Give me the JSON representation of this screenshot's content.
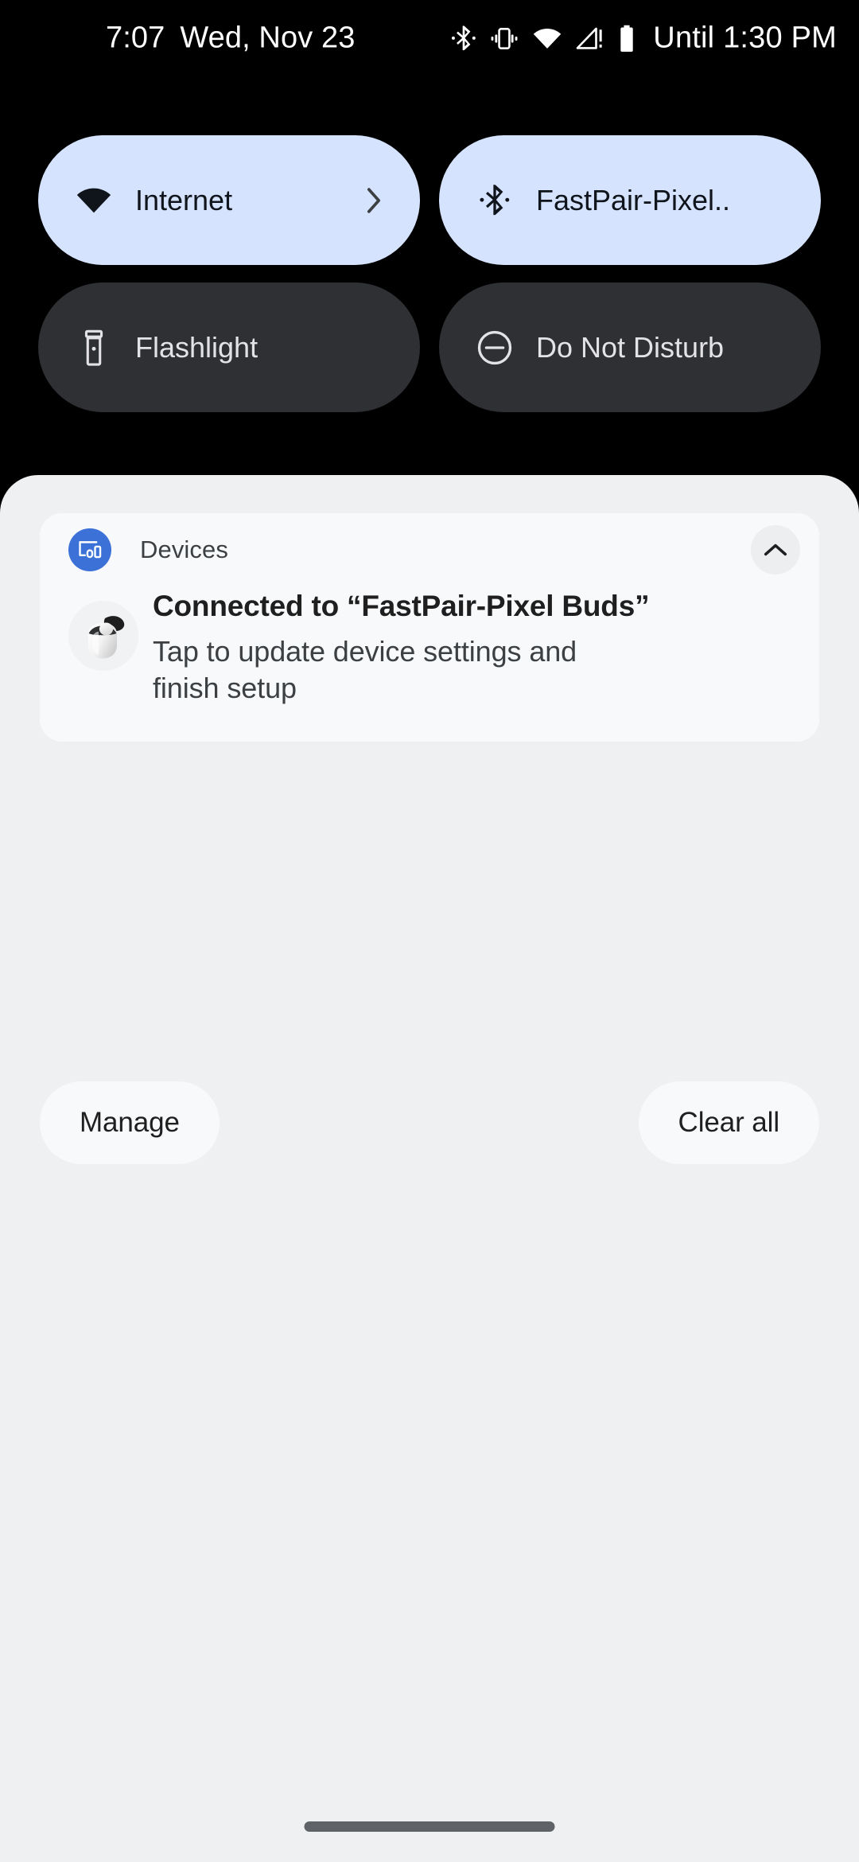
{
  "status_bar": {
    "time": "7:07",
    "date": "Wed, Nov 23",
    "icons": [
      "bluetooth-icon",
      "vibrate-icon",
      "wifi-icon",
      "signal-no-service-icon",
      "battery-icon"
    ],
    "battery_note": "Until 1:30 PM"
  },
  "quick_settings": {
    "tiles": [
      {
        "label": "Internet",
        "icon": "wifi-icon",
        "state": "on",
        "has_chevron": true
      },
      {
        "label": "FastPair-Pixel..",
        "icon": "bluetooth-icon",
        "state": "on",
        "has_chevron": false
      },
      {
        "label": "Flashlight",
        "icon": "flashlight-icon",
        "state": "off",
        "has_chevron": false
      },
      {
        "label": "Do Not Disturb",
        "icon": "do-not-disturb-icon",
        "state": "off",
        "has_chevron": false
      }
    ]
  },
  "notification": {
    "app_name": "Devices",
    "app_icon": "devices-cast-icon",
    "collapse_icon": "chevron-up-icon",
    "thumbnail": "pixel-buds-case-image",
    "title": "Connected to “FastPair-Pixel Buds”",
    "body": "Tap to update device settings and finish setup"
  },
  "actions": {
    "manage": "Manage",
    "clear_all": "Clear all"
  },
  "colors": {
    "tile_on_bg": "#D5E3FF",
    "tile_off_bg": "#2F3033",
    "panel_bg": "#EFF0F2",
    "card_bg": "#F8F9FA",
    "app_icon_blue": "#3C71D8",
    "gesture_bar": "#5F6368"
  },
  "navigation": {
    "gesture_bar": "home-gesture-bar"
  }
}
